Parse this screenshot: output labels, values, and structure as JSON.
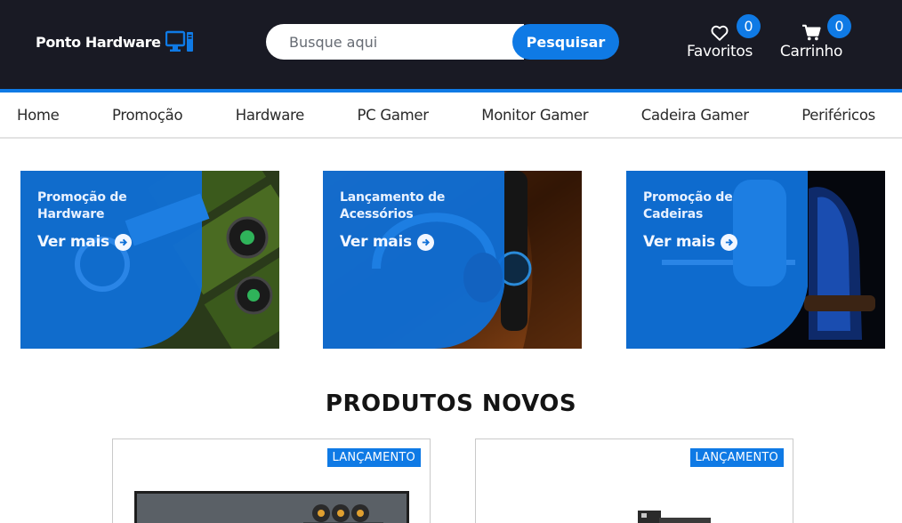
{
  "header": {
    "logo_text": "Ponto Hardware",
    "logo_icon": "desktop-computer-icon",
    "search": {
      "placeholder": "Busque aqui",
      "button_label": "Pesquisar"
    },
    "favorites": {
      "label": "Favoritos",
      "count": "0",
      "icon": "heart-icon"
    },
    "cart": {
      "label": "Carrinho",
      "count": "0",
      "icon": "shopping-cart-icon"
    }
  },
  "nav": {
    "items": [
      "Home",
      "Promoção",
      "Hardware",
      "PC Gamer",
      "Monitor Gamer",
      "Cadeira Gamer",
      "Periféricos"
    ]
  },
  "banners": [
    {
      "title": "Promoção de Hardware",
      "cta": "Ver mais"
    },
    {
      "title": "Lançamento de Acessórios",
      "cta": "Ver mais"
    },
    {
      "title": "Promoção de Cadeiras",
      "cta": "Ver mais"
    }
  ],
  "products_section": {
    "title": "PRODUTOS NOVOS",
    "cards": [
      {
        "badge": "LANÇAMENTO"
      },
      {
        "badge": "LANÇAMENTO"
      }
    ]
  },
  "colors": {
    "header_bg": "#191a24",
    "accent": "#0f7ae5"
  }
}
